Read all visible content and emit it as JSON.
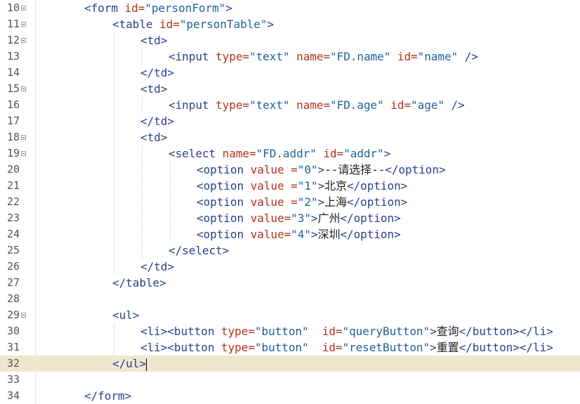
{
  "editor": {
    "lines": [
      {
        "n": "10",
        "fold": true,
        "indent": 2,
        "segments": [
          [
            "tg",
            "<form "
          ],
          [
            "at",
            "id="
          ],
          [
            "vl",
            "\"personForm\""
          ],
          [
            "tg",
            ">"
          ]
        ]
      },
      {
        "n": "11",
        "fold": true,
        "indent": 3,
        "segments": [
          [
            "tg",
            "<table "
          ],
          [
            "at",
            "id="
          ],
          [
            "vl",
            "\"personTable\""
          ],
          [
            "tg",
            ">"
          ]
        ]
      },
      {
        "n": "12",
        "fold": true,
        "indent": 4,
        "segments": [
          [
            "tg",
            "<td>"
          ]
        ]
      },
      {
        "n": "13",
        "fold": false,
        "indent": 5,
        "segments": [
          [
            "tg",
            "<input "
          ],
          [
            "at",
            "type="
          ],
          [
            "vl",
            "\"text\" "
          ],
          [
            "at",
            "name="
          ],
          [
            "vl",
            "\"FD.name\" "
          ],
          [
            "at",
            "id="
          ],
          [
            "vl",
            "\"name\" "
          ],
          [
            "tg",
            "/>"
          ]
        ]
      },
      {
        "n": "14",
        "fold": false,
        "indent": 4,
        "segments": [
          [
            "tg",
            "</td>"
          ]
        ]
      },
      {
        "n": "15",
        "fold": true,
        "indent": 4,
        "segments": [
          [
            "tg",
            "<td>"
          ]
        ]
      },
      {
        "n": "16",
        "fold": false,
        "indent": 5,
        "segments": [
          [
            "tg",
            "<input "
          ],
          [
            "at",
            "type="
          ],
          [
            "vl",
            "\"text\" "
          ],
          [
            "at",
            "name="
          ],
          [
            "vl",
            "\"FD.age\" "
          ],
          [
            "at",
            "id="
          ],
          [
            "vl",
            "\"age\" "
          ],
          [
            "tg",
            "/>"
          ]
        ]
      },
      {
        "n": "17",
        "fold": false,
        "indent": 4,
        "segments": [
          [
            "tg",
            "</td>"
          ]
        ]
      },
      {
        "n": "18",
        "fold": true,
        "indent": 4,
        "segments": [
          [
            "tg",
            "<td>"
          ]
        ]
      },
      {
        "n": "19",
        "fold": true,
        "indent": 5,
        "segments": [
          [
            "tg",
            "<select "
          ],
          [
            "at",
            "name="
          ],
          [
            "vl",
            "\"FD.addr\" "
          ],
          [
            "at",
            "id="
          ],
          [
            "vl",
            "\"addr\""
          ],
          [
            "tg",
            ">"
          ]
        ]
      },
      {
        "n": "20",
        "fold": false,
        "indent": 6,
        "segments": [
          [
            "tg",
            "<option "
          ],
          [
            "at",
            "value ="
          ],
          [
            "vl",
            "\"0\""
          ],
          [
            "tg",
            ">"
          ],
          [
            "tx",
            "--请选择--"
          ],
          [
            "tg",
            "</option>"
          ]
        ]
      },
      {
        "n": "21",
        "fold": false,
        "indent": 6,
        "segments": [
          [
            "tg",
            "<option "
          ],
          [
            "at",
            "value ="
          ],
          [
            "vl",
            "\"1\""
          ],
          [
            "tg",
            ">"
          ],
          [
            "tx",
            "北京"
          ],
          [
            "tg",
            "</option>"
          ]
        ]
      },
      {
        "n": "22",
        "fold": false,
        "indent": 6,
        "segments": [
          [
            "tg",
            "<option "
          ],
          [
            "at",
            "value ="
          ],
          [
            "vl",
            "\"2\""
          ],
          [
            "tg",
            ">"
          ],
          [
            "tx",
            "上海"
          ],
          [
            "tg",
            "</option>"
          ]
        ]
      },
      {
        "n": "23",
        "fold": false,
        "indent": 6,
        "segments": [
          [
            "tg",
            "<option "
          ],
          [
            "at",
            "value="
          ],
          [
            "vl",
            "\"3\""
          ],
          [
            "tg",
            ">"
          ],
          [
            "tx",
            "广州"
          ],
          [
            "tg",
            "</option>"
          ]
        ]
      },
      {
        "n": "24",
        "fold": false,
        "indent": 6,
        "segments": [
          [
            "tg",
            "<option "
          ],
          [
            "at",
            "value="
          ],
          [
            "vl",
            "\"4\""
          ],
          [
            "tg",
            ">"
          ],
          [
            "tx",
            "深圳"
          ],
          [
            "tg",
            "</option>"
          ]
        ]
      },
      {
        "n": "25",
        "fold": false,
        "indent": 5,
        "segments": [
          [
            "tg",
            "</select>"
          ]
        ]
      },
      {
        "n": "26",
        "fold": false,
        "indent": 4,
        "segments": [
          [
            "tg",
            "</td>"
          ]
        ]
      },
      {
        "n": "27",
        "fold": false,
        "indent": 3,
        "segments": [
          [
            "tg",
            "</table>"
          ]
        ]
      },
      {
        "n": "28",
        "fold": false,
        "indent": 0,
        "segments": []
      },
      {
        "n": "29",
        "fold": true,
        "indent": 3,
        "segments": [
          [
            "tg",
            "<ul>"
          ]
        ]
      },
      {
        "n": "30",
        "fold": false,
        "indent": 4,
        "segments": [
          [
            "tg",
            "<li><button "
          ],
          [
            "at",
            "type="
          ],
          [
            "vl",
            "\"button\"  "
          ],
          [
            "at",
            "id="
          ],
          [
            "vl",
            "\"queryButton\""
          ],
          [
            "tg",
            ">"
          ],
          [
            "tx",
            "查询"
          ],
          [
            "tg",
            "</button></li>"
          ]
        ]
      },
      {
        "n": "31",
        "fold": false,
        "indent": 4,
        "segments": [
          [
            "tg",
            "<li><button "
          ],
          [
            "at",
            "type="
          ],
          [
            "vl",
            "\"button\"  "
          ],
          [
            "at",
            "id="
          ],
          [
            "vl",
            "\"resetButton\""
          ],
          [
            "tg",
            ">"
          ],
          [
            "tx",
            "重置"
          ],
          [
            "tg",
            "</button></li>"
          ]
        ]
      },
      {
        "n": "32",
        "fold": false,
        "indent": 3,
        "current": true,
        "segments": [
          [
            "tg",
            "</ul>"
          ]
        ]
      },
      {
        "n": "33",
        "fold": false,
        "indent": 0,
        "segments": []
      },
      {
        "n": "34",
        "fold": false,
        "indent": 2,
        "segments": [
          [
            "tg",
            "</form>"
          ]
        ]
      }
    ]
  }
}
